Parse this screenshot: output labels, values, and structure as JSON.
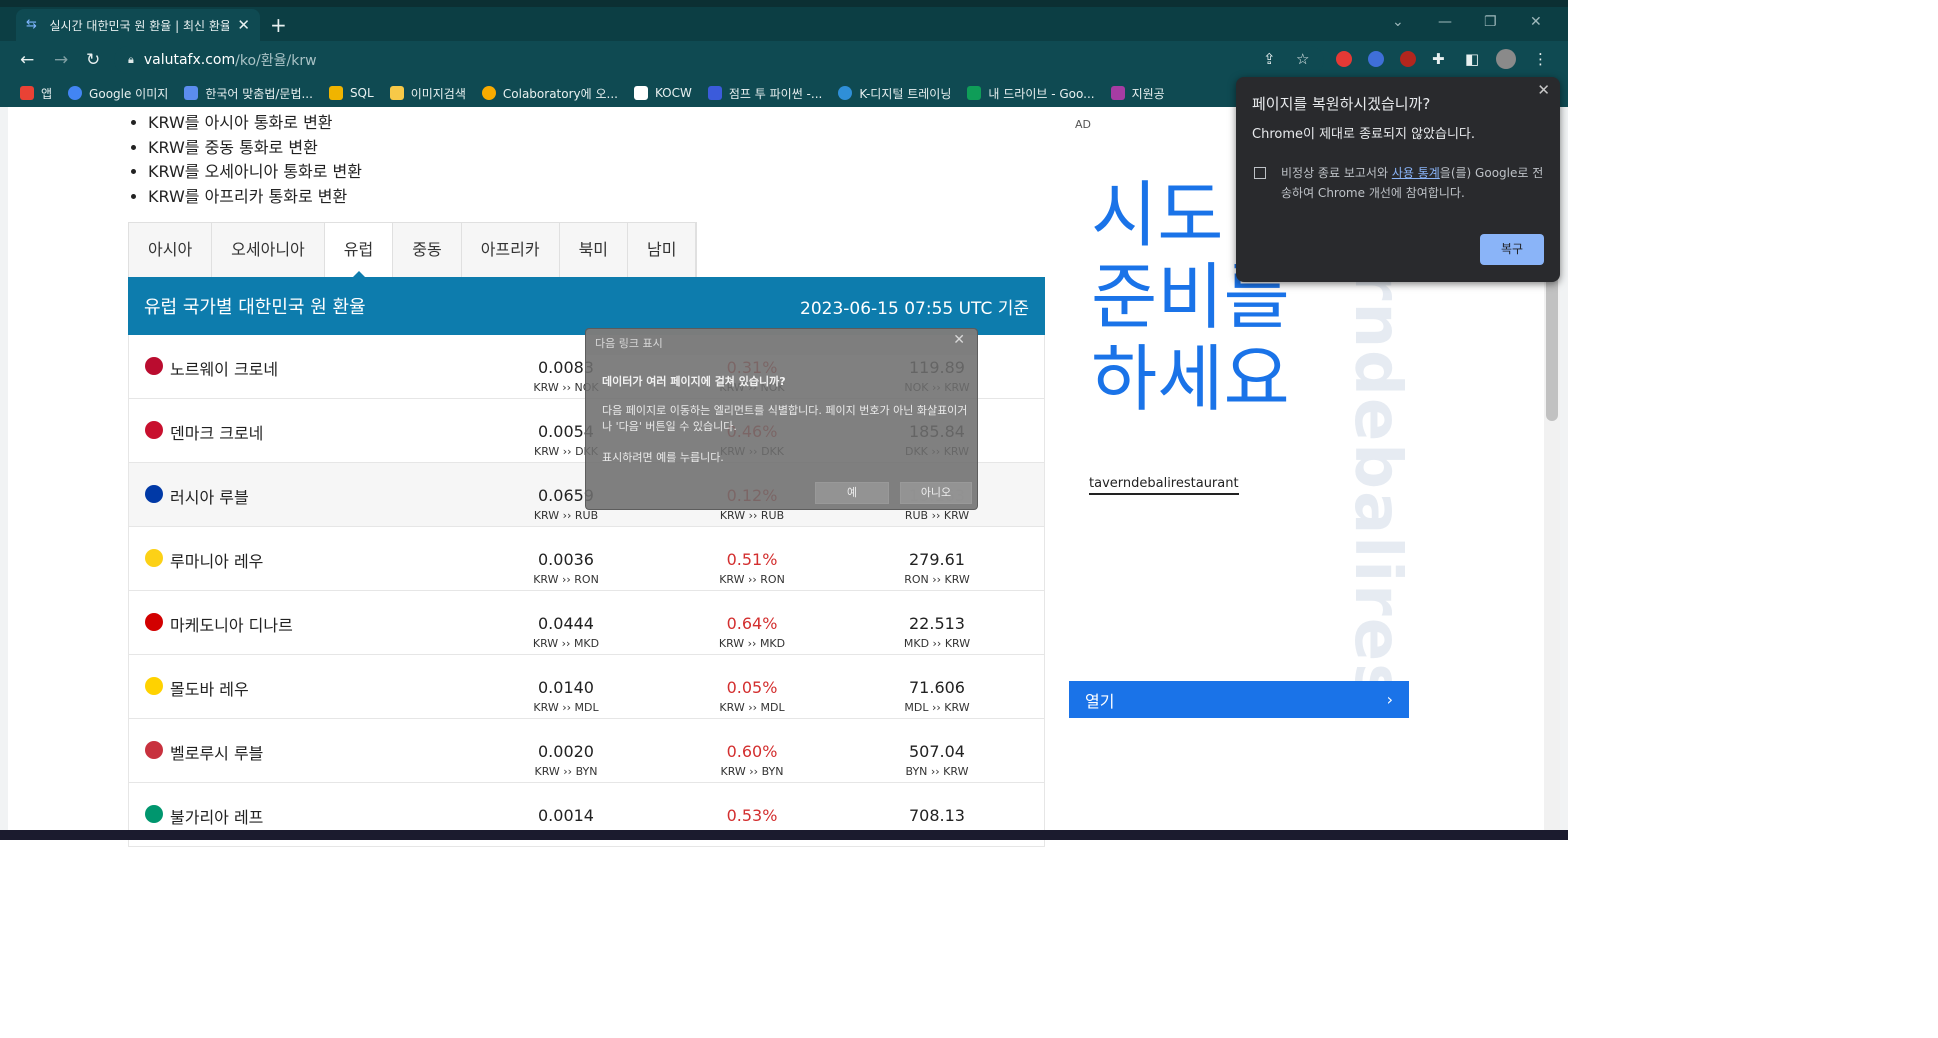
{
  "browser": {
    "tab_title": "실시간 대한민국 원 환율 | 최신 환율",
    "new_tab": "+",
    "url_domain": "valutafx.com",
    "url_path": "/ko/환율/krw",
    "bookmarks": [
      {
        "label": "앱",
        "color": "#e94235"
      },
      {
        "label": "Google 이미지",
        "color": "#4285f4"
      },
      {
        "label": "한국어 맞춤법/문법...",
        "color": "#5b8def"
      },
      {
        "label": "SQL",
        "color": "#f0b400"
      },
      {
        "label": "이미지검색",
        "color": "#f7c948"
      },
      {
        "label": "Colaboratory에 오...",
        "color": "#f9ab00"
      },
      {
        "label": "KOCW",
        "color": "#ffffff"
      },
      {
        "label": "점프 투 파이썬 -...",
        "color": "#3b5bdb"
      },
      {
        "label": "K-디지털 트레이닝",
        "color": "#2f8fd8"
      },
      {
        "label": "내 드라이브 - Goo...",
        "color": "#0f9d58"
      },
      {
        "label": "지원공",
        "color": "#a63ca3"
      }
    ]
  },
  "page": {
    "convert_links": [
      "KRW를 아시아 통화로 변환",
      "KRW를 중동 통화로 변환",
      "KRW를 오세아니아 통화로 변환",
      "KRW를 아프리카 통화로 변환"
    ],
    "regions": [
      "아시아",
      "오세아니아",
      "유럽",
      "중동",
      "아프리카",
      "북미",
      "남미"
    ],
    "active_region": "유럽",
    "table_title": "유럽 국가별 대한민국 원 환율",
    "timestamp": "2023-06-15 07:55 UTC 기준",
    "rows": [
      {
        "name": "노르웨이 크로네",
        "rate": "0.0083",
        "rate_pair": "KRW ›› NOK",
        "change": "0.31%",
        "change_pair": "KRW ›› NOK",
        "inverse": "119.89",
        "inverse_pair": "NOK ›› KRW",
        "flag": "#ba0c2f"
      },
      {
        "name": "덴마크 크로네",
        "rate": "0.0054",
        "rate_pair": "KRW ›› DKK",
        "change": "0.46%",
        "change_pair": "KRW ›› DKK",
        "inverse": "185.84",
        "inverse_pair": "DKK ›› KRW",
        "flag": "#c8102e"
      },
      {
        "name": "러시아 루블",
        "rate": "0.0659",
        "rate_pair": "KRW ›› RUB",
        "change": "0.12%",
        "change_pair": "KRW ›› RUB",
        "inverse": "15.163",
        "inverse_pair": "RUB ›› KRW",
        "flag": "#0039a6"
      },
      {
        "name": "루마니아 레우",
        "rate": "0.0036",
        "rate_pair": "KRW ›› RON",
        "change": "0.51%",
        "change_pair": "KRW ›› RON",
        "inverse": "279.61",
        "inverse_pair": "RON ›› KRW",
        "flag": "#fcd116"
      },
      {
        "name": "마케도니아 디나르",
        "rate": "0.0444",
        "rate_pair": "KRW ›› MKD",
        "change": "0.64%",
        "change_pair": "KRW ›› MKD",
        "inverse": "22.513",
        "inverse_pair": "MKD ›› KRW",
        "flag": "#d20000"
      },
      {
        "name": "몰도바 레우",
        "rate": "0.0140",
        "rate_pair": "KRW ›› MDL",
        "change": "0.05%",
        "change_pair": "KRW ›› MDL",
        "inverse": "71.606",
        "inverse_pair": "MDL ›› KRW",
        "flag": "#ffd200"
      },
      {
        "name": "벨로루시 루블",
        "rate": "0.0020",
        "rate_pair": "KRW ›› BYN",
        "change": "0.60%",
        "change_pair": "KRW ›› BYN",
        "inverse": "507.04",
        "inverse_pair": "BYN ›› KRW",
        "flag": "#c8313e"
      },
      {
        "name": "불가리아 레프",
        "rate": "0.0014",
        "rate_pair": "KRW ›› BGN",
        "change": "0.53%",
        "change_pair": "KRW ›› BGN",
        "inverse": "708.13",
        "inverse_pair": "BGN ›› KRW",
        "flag": "#00966e"
      }
    ]
  },
  "ad": {
    "tag": "AD",
    "headline_lines": [
      "시도",
      "준비를",
      "하세요"
    ],
    "bg_text": "taverndebalirestaurant",
    "brand": "taverndebalirestaurant",
    "cta": "열기",
    "accent": "#1a73e8"
  },
  "restore_popup": {
    "title": "페이지를 복원하시겠습니까?",
    "subtitle": "Chrome이 제대로 종료되지 않았습니다.",
    "checkbox_pre": "비정상 종료 보고서와 ",
    "checkbox_link": "사용 통계",
    "checkbox_post": "을(를) Google로 전송하여 Chrome 개선에 참여합니다.",
    "button": "복구"
  },
  "next_link_dialog": {
    "header": "다음 링크 표시",
    "question": "데이터가 여러 페이지에 걸쳐 있습니까?",
    "body": "다음 페이지로 이동하는 엘리먼트를 식별합니다. 페이지 번호가 아닌 화살표이거나 '다음' 버튼일 수 있습니다.",
    "note": "표시하려면 예를 누릅니다.",
    "yes": "예",
    "no": "아니오"
  }
}
